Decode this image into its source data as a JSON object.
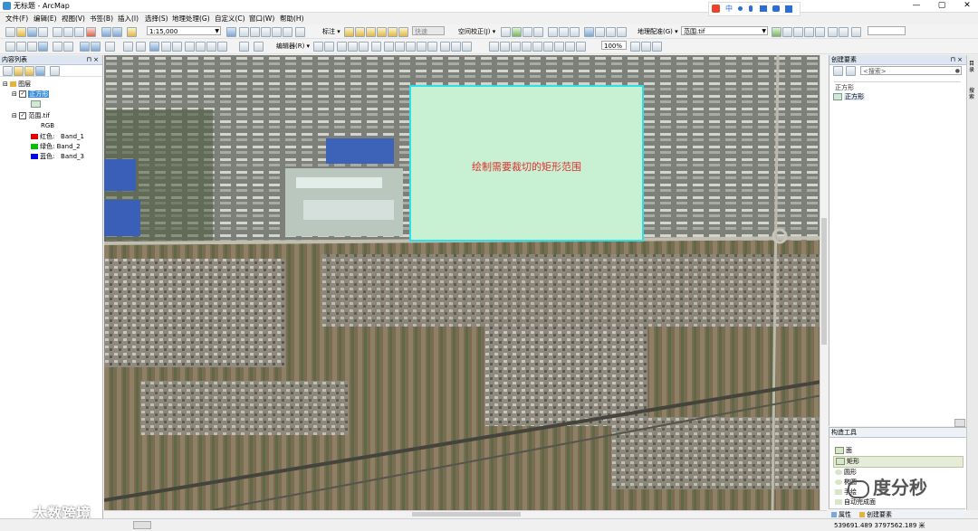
{
  "window": {
    "title": "无标题 - ArcMap",
    "controls": [
      "—",
      "▢",
      "✕"
    ]
  },
  "menubar": {
    "items": [
      "文件(F)",
      "编辑(E)",
      "视图(V)",
      "书签(B)",
      "插入(I)",
      "选择(S)",
      "地理处理(G)",
      "自定义(C)",
      "窗口(W)",
      "帮助(H)"
    ]
  },
  "toolbar": {
    "scale_value": "1:15,000",
    "editor_label": "标注 ▾",
    "fast_label": "快速",
    "georef_label": "空间校正(J) ▾",
    "editor_menu": "编辑器(R) ▾",
    "zoom_percent": "100%",
    "georeferencing_label": "地理配准(G) ▾",
    "layer_combo": "范围.tif",
    "ime_label": "中"
  },
  "toc": {
    "title": "内容列表",
    "root": "图层",
    "layer_square": "正方形",
    "layer_raster": "范围.tif",
    "rgb_label": "RGB",
    "bands": [
      {
        "channel": "红色:",
        "band": "Band_1",
        "color": "#e00000"
      },
      {
        "channel": "绿色:",
        "band": "Band_2",
        "color": "#00c000"
      },
      {
        "channel": "蓝色:",
        "band": "Band_3",
        "color": "#0000e0"
      }
    ]
  },
  "map": {
    "annotation": "绘制需要裁切的矩形范围",
    "annotation_color": "#e03030",
    "polygon_fill": "#c8f0d2",
    "polygon_stroke": "#2de0e8"
  },
  "create_features": {
    "title": "创建要素",
    "search_placeholder": "<搜索>",
    "group": "正方形",
    "template": "正方形"
  },
  "construction_tools": {
    "title": "构造工具",
    "items": [
      "面",
      "矩形",
      "圆形",
      "椭圆",
      "手绘",
      "自动完成面"
    ],
    "tab_attributes": "属性",
    "tab_create": "创建要素"
  },
  "side_strip": {
    "tab1": "目录",
    "tab2": "搜索"
  },
  "status": {
    "coordinates": "539691.489  3797562.189 米"
  },
  "watermarks": {
    "left": "大数跨境",
    "right": "度分秒"
  }
}
